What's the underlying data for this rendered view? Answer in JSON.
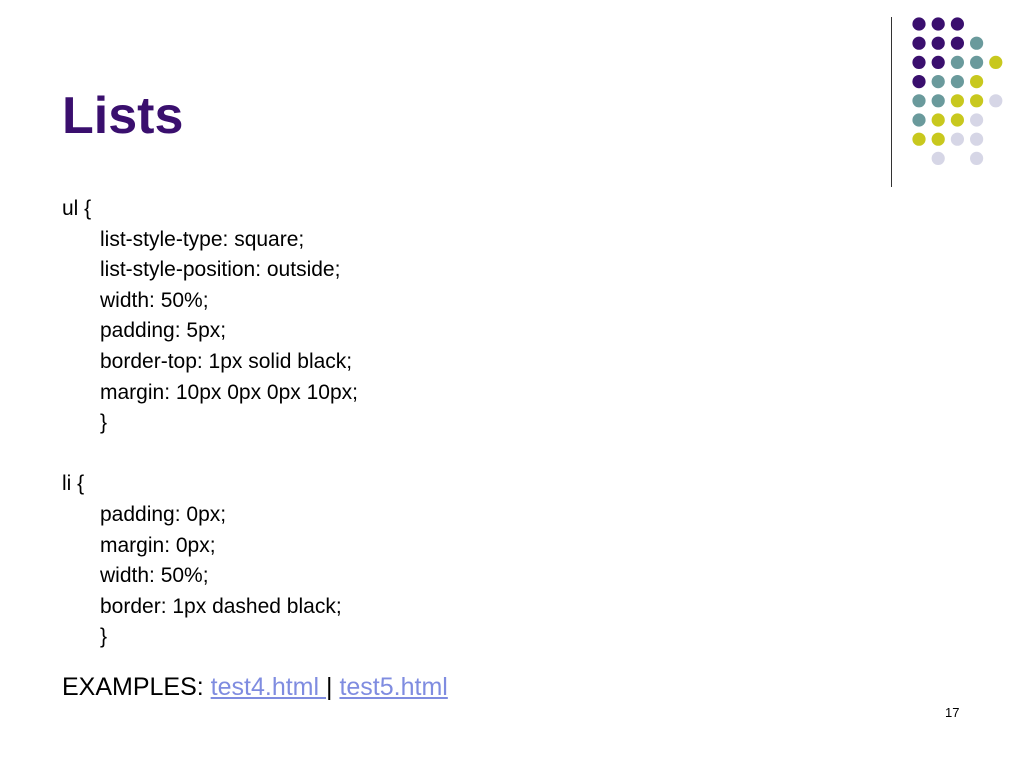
{
  "slide": {
    "title": "Lists",
    "code_lines": [
      {
        "text": "ul {",
        "indent": false
      },
      {
        "text": "list-style-type: square;",
        "indent": true
      },
      {
        "text": "list-style-position: outside;",
        "indent": true
      },
      {
        "text": "width: 50%;",
        "indent": true
      },
      {
        "text": "padding: 5px;",
        "indent": true
      },
      {
        "text": "border-top: 1px solid black;",
        "indent": true
      },
      {
        "text": "margin: 10px 0px 0px 10px;",
        "indent": true
      },
      {
        "text": "}",
        "indent": true
      },
      {
        "text": "",
        "indent": false
      },
      {
        "text": "li {",
        "indent": false
      },
      {
        "text": "padding: 0px;",
        "indent": true
      },
      {
        "text": "margin: 0px;",
        "indent": true
      },
      {
        "text": "width: 50%;",
        "indent": true
      },
      {
        "text": "border: 1px dashed black;",
        "indent": true
      },
      {
        "text": "}",
        "indent": true
      }
    ],
    "examples": {
      "label": "EXAMPLES: ",
      "link1": "test4.html ",
      "separator": "|",
      "link2": "test5.html"
    },
    "page_number": "17"
  },
  "colors": {
    "title": "#3a0f6e",
    "purple": "#3a0f6e",
    "teal": "#6a9a9c",
    "yellow": "#c8c81e",
    "lavender": "#d6d6e6",
    "link": "#7f8ce0"
  }
}
